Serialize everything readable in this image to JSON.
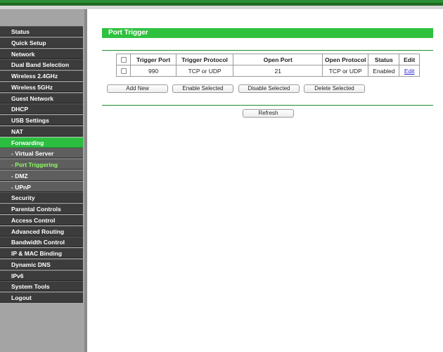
{
  "sidebar": {
    "items": [
      {
        "label": "Status"
      },
      {
        "label": "Quick Setup"
      },
      {
        "label": "Network"
      },
      {
        "label": "Dual Band Selection"
      },
      {
        "label": "Wireless 2.4GHz"
      },
      {
        "label": "Wireless 5GHz"
      },
      {
        "label": "Guest Network"
      },
      {
        "label": "DHCP"
      },
      {
        "label": "USB Settings"
      },
      {
        "label": "NAT"
      },
      {
        "label": "Forwarding"
      },
      {
        "label": "- Virtual Server"
      },
      {
        "label": "- Port Triggering"
      },
      {
        "label": "- DMZ"
      },
      {
        "label": "- UPnP"
      },
      {
        "label": "Security"
      },
      {
        "label": "Parental Controls"
      },
      {
        "label": "Access Control"
      },
      {
        "label": "Advanced Routing"
      },
      {
        "label": "Bandwidth Control"
      },
      {
        "label": "IP & MAC Binding"
      },
      {
        "label": "Dynamic DNS"
      },
      {
        "label": "IPv6"
      },
      {
        "label": "System Tools"
      },
      {
        "label": "Logout"
      }
    ]
  },
  "main": {
    "title": "Port Trigger",
    "table": {
      "headers": [
        "Trigger Port",
        "Trigger Protocol",
        "Open Port",
        "Open Protocol",
        "Status",
        "Edit"
      ],
      "rows": [
        {
          "trigger_port": "990",
          "trigger_protocol": "TCP or UDP",
          "open_port": "21",
          "open_protocol": "TCP or UDP",
          "status": "Enabled",
          "edit": "Edit"
        }
      ]
    },
    "buttons": {
      "add_new": "Add New",
      "enable_selected": "Enable Selected",
      "disable_selected": "Disable Selected",
      "delete_selected": "Delete Selected",
      "refresh": "Refresh"
    }
  },
  "colors": {
    "accent_green": "#2ec13e",
    "menu_dark": "#3c3c3c",
    "menu_sub": "#5e5e5e",
    "active_sub_text": "#8dfc60",
    "link": "#2b2bd8"
  }
}
